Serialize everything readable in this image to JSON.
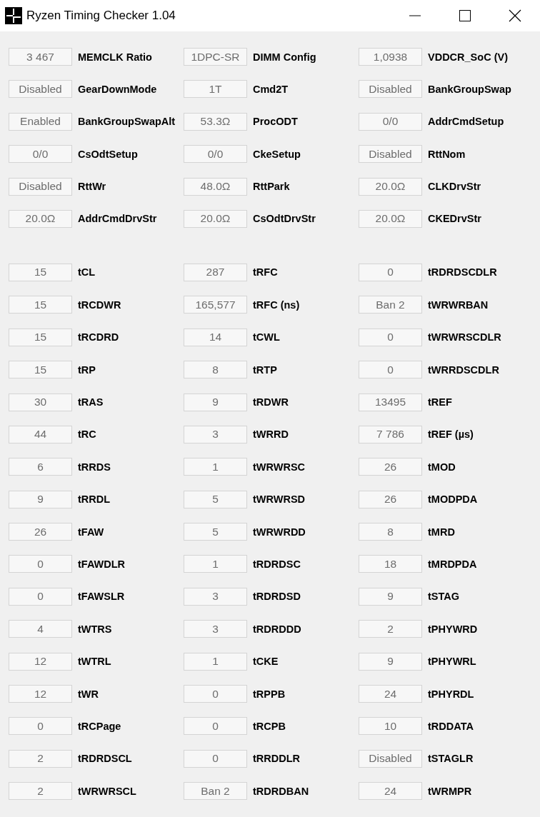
{
  "window": {
    "title": "Ryzen Timing Checker 1.04"
  },
  "sections": [
    {
      "fields": [
        {
          "reading": "3 467",
          "label": "MEMCLK Ratio"
        },
        {
          "reading": "1DPC-SR",
          "label": "DIMM Config"
        },
        {
          "reading": "1,0938",
          "label": "VDDCR_SoC (V)"
        },
        {
          "reading": "Disabled",
          "label": "GearDownMode"
        },
        {
          "reading": "1T",
          "label": "Cmd2T"
        },
        {
          "reading": "Disabled",
          "label": "BankGroupSwap"
        },
        {
          "reading": "Enabled",
          "label": "BankGroupSwapAlt"
        },
        {
          "reading": "53.3Ω",
          "label": "ProcODT"
        },
        {
          "reading": "0/0",
          "label": "AddrCmdSetup"
        },
        {
          "reading": "0/0",
          "label": "CsOdtSetup"
        },
        {
          "reading": "0/0",
          "label": "CkeSetup"
        },
        {
          "reading": "Disabled",
          "label": "RttNom"
        },
        {
          "reading": "Disabled",
          "label": "RttWr"
        },
        {
          "reading": "48.0Ω",
          "label": "RttPark"
        },
        {
          "reading": "20.0Ω",
          "label": "CLKDrvStr"
        },
        {
          "reading": "20.0Ω",
          "label": "AddrCmdDrvStr"
        },
        {
          "reading": "20.0Ω",
          "label": "CsOdtDrvStr"
        },
        {
          "reading": "20.0Ω",
          "label": "CKEDrvStr"
        }
      ]
    },
    {
      "fields": [
        {
          "reading": "15",
          "label": "tCL"
        },
        {
          "reading": "287",
          "label": "tRFC"
        },
        {
          "reading": "0",
          "label": "tRDRDSCDLR"
        },
        {
          "reading": "15",
          "label": "tRCDWR"
        },
        {
          "reading": "165,577",
          "label": "tRFC (ns)"
        },
        {
          "reading": "Ban 2",
          "label": "tWRWRBAN"
        },
        {
          "reading": "15",
          "label": "tRCDRD"
        },
        {
          "reading": "14",
          "label": "tCWL"
        },
        {
          "reading": "0",
          "label": "tWRWRSCDLR"
        },
        {
          "reading": "15",
          "label": "tRP"
        },
        {
          "reading": "8",
          "label": "tRTP"
        },
        {
          "reading": "0",
          "label": "tWRRDSCDLR"
        },
        {
          "reading": "30",
          "label": "tRAS"
        },
        {
          "reading": "9",
          "label": "tRDWR"
        },
        {
          "reading": "13495",
          "label": "tREF"
        },
        {
          "reading": "44",
          "label": "tRC"
        },
        {
          "reading": "3",
          "label": "tWRRD"
        },
        {
          "reading": "7 786",
          "label": "tREF (µs)"
        },
        {
          "reading": "6",
          "label": "tRRDS"
        },
        {
          "reading": "1",
          "label": "tWRWRSC"
        },
        {
          "reading": "26",
          "label": "tMOD"
        },
        {
          "reading": "9",
          "label": "tRRDL"
        },
        {
          "reading": "5",
          "label": "tWRWRSD"
        },
        {
          "reading": "26",
          "label": "tMODPDA"
        },
        {
          "reading": "26",
          "label": "tFAW"
        },
        {
          "reading": "5",
          "label": "tWRWRDD"
        },
        {
          "reading": "8",
          "label": "tMRD"
        },
        {
          "reading": "0",
          "label": "tFAWDLR"
        },
        {
          "reading": "1",
          "label": "tRDRDSC"
        },
        {
          "reading": "18",
          "label": "tMRDPDA"
        },
        {
          "reading": "0",
          "label": "tFAWSLR"
        },
        {
          "reading": "3",
          "label": "tRDRDSD"
        },
        {
          "reading": "9",
          "label": "tSTAG"
        },
        {
          "reading": "4",
          "label": "tWTRS"
        },
        {
          "reading": "3",
          "label": "tRDRDDD"
        },
        {
          "reading": "2",
          "label": "tPHYWRD"
        },
        {
          "reading": "12",
          "label": "tWTRL"
        },
        {
          "reading": "1",
          "label": "tCKE"
        },
        {
          "reading": "9",
          "label": "tPHYWRL"
        },
        {
          "reading": "12",
          "label": "tWR"
        },
        {
          "reading": "0",
          "label": "tRPPB"
        },
        {
          "reading": "24",
          "label": "tPHYRDL"
        },
        {
          "reading": "0",
          "label": "tRCPage"
        },
        {
          "reading": "0",
          "label": "tRCPB"
        },
        {
          "reading": "10",
          "label": "tRDDATA"
        },
        {
          "reading": "2",
          "label": "tRDRDSCL"
        },
        {
          "reading": "0",
          "label": "tRRDDLR"
        },
        {
          "reading": "Disabled",
          "label": "tSTAGLR"
        },
        {
          "reading": "2",
          "label": "tWRWRSCL"
        },
        {
          "reading": "Ban 2",
          "label": "tRDRDBAN"
        },
        {
          "reading": "24",
          "label": "tWRMPR"
        }
      ]
    }
  ]
}
